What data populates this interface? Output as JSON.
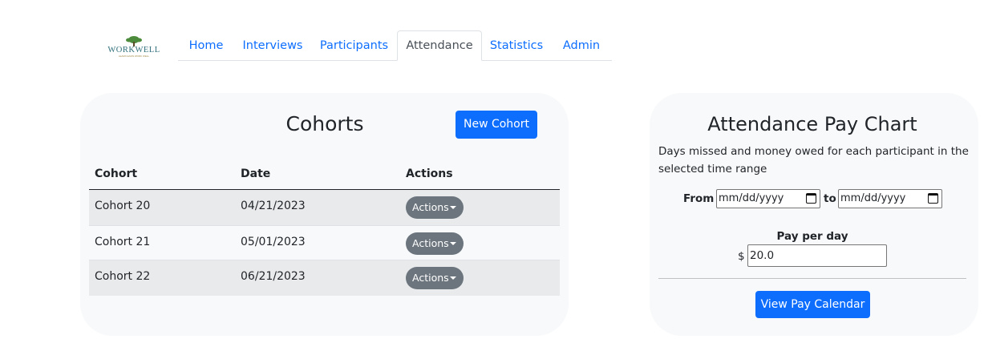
{
  "logo": {
    "text": "WORKWELL",
    "tagline": "LEARN EARN WORK WELL",
    "icon": "tree-logo-icon",
    "colors": {
      "text": "#2f6f7a",
      "leaf": "#4b8b3b"
    }
  },
  "nav": {
    "tabs": [
      {
        "label": "Home"
      },
      {
        "label": "Interviews"
      },
      {
        "label": "Participants"
      },
      {
        "label": "Attendance",
        "active": true
      },
      {
        "label": "Statistics"
      },
      {
        "label": "Admin"
      }
    ]
  },
  "cohorts": {
    "title": "Cohorts",
    "new_button": "New Cohort",
    "columns": [
      "Cohort",
      "Date",
      "Actions"
    ],
    "rows": [
      {
        "cohort": "Cohort 20",
        "date": "04/21/2023",
        "action": "Actions"
      },
      {
        "cohort": "Cohort 21",
        "date": "05/01/2023",
        "action": "Actions"
      },
      {
        "cohort": "Cohort 22",
        "date": "06/21/2023",
        "action": "Actions"
      }
    ]
  },
  "pay_chart": {
    "title": "Attendance Pay Chart",
    "description": "Days missed and money owed for each participant in the selected time range",
    "from_label": "From",
    "to_label": "to",
    "from_placeholder": "mm/dd/yyyy",
    "to_placeholder": "mm/dd/yyyy",
    "pay_label": "Pay per day",
    "currency": "$",
    "pay_value": "20.0",
    "view_button": "View Pay Calendar"
  },
  "colors": {
    "primary": "#0d6efd",
    "secondary": "#6c757d",
    "card_bg": "#f8f9fa"
  }
}
